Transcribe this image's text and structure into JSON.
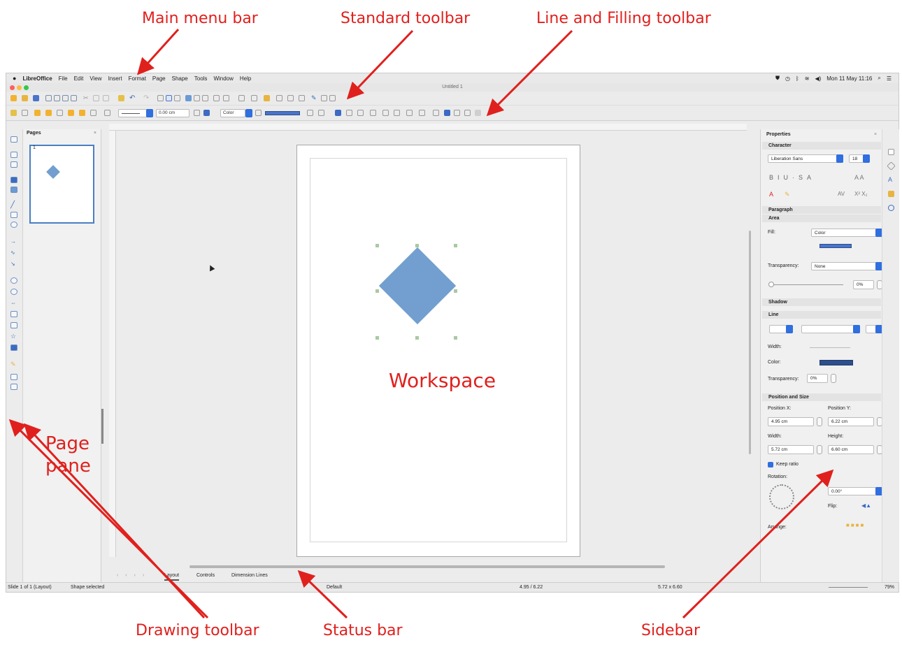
{
  "callouts": {
    "main_menu_bar": "Main menu bar",
    "standard_toolbar": "Standard toolbar",
    "line_filling_toolbar": "Line and Filling toolbar",
    "page_pane": "Page\npane",
    "workspace": "Workspace",
    "drawing_toolbar": "Drawing toolbar",
    "status_bar": "Status bar",
    "sidebar": "Sidebar"
  },
  "menu": {
    "app": "LibreOffice",
    "items": [
      "File",
      "Edit",
      "View",
      "Insert",
      "Format",
      "Page",
      "Shape",
      "Tools",
      "Window",
      "Help"
    ],
    "clock": "Mon 11 May 11:16"
  },
  "window_title": "Untitled 1",
  "toolbar": {
    "line_width": "0.00 cm",
    "fill_type": "Color"
  },
  "pages_pane": {
    "title": "Pages",
    "page_number": "1"
  },
  "tabs": [
    "Layout",
    "Controls",
    "Dimension Lines"
  ],
  "status": {
    "slide": "Slide 1 of 1 (Layout)",
    "selection": "Shape selected",
    "master": "Default",
    "position": "4.95 / 6.22",
    "size": "5.72 x 6.60",
    "zoom": "79%"
  },
  "sidebar": {
    "title": "Properties",
    "character": {
      "header": "Character",
      "font": "Liberation Sans",
      "size": "18"
    },
    "paragraph_header": "Paragraph",
    "area": {
      "header": "Area",
      "fill_label": "Fill:",
      "fill_value": "Color",
      "transparency_label": "Transparency:",
      "transparency_value": "None",
      "percent": "0%"
    },
    "shadow_header": "Shadow",
    "line": {
      "header": "Line",
      "width_label": "Width:",
      "color_label": "Color:",
      "transparency_label": "Transparency:",
      "transparency_value": "0%"
    },
    "position_size": {
      "header": "Position and Size",
      "pos_x_label": "Position X:",
      "pos_x": "4.95 cm",
      "pos_y_label": "Position Y:",
      "pos_y": "6.22 cm",
      "width_label": "Width:",
      "width": "5.72 cm",
      "height_label": "Height:",
      "height": "6.60 cm",
      "keep_ratio": "Keep ratio",
      "rotation_label": "Rotation:",
      "rotation": "0.00°",
      "flip_label": "Flip:",
      "arrange_label": "Arrange:"
    }
  },
  "colors": {
    "callout": "#e0201d",
    "shape_fill": "#729fcf",
    "accent": "#2f6fe0"
  }
}
